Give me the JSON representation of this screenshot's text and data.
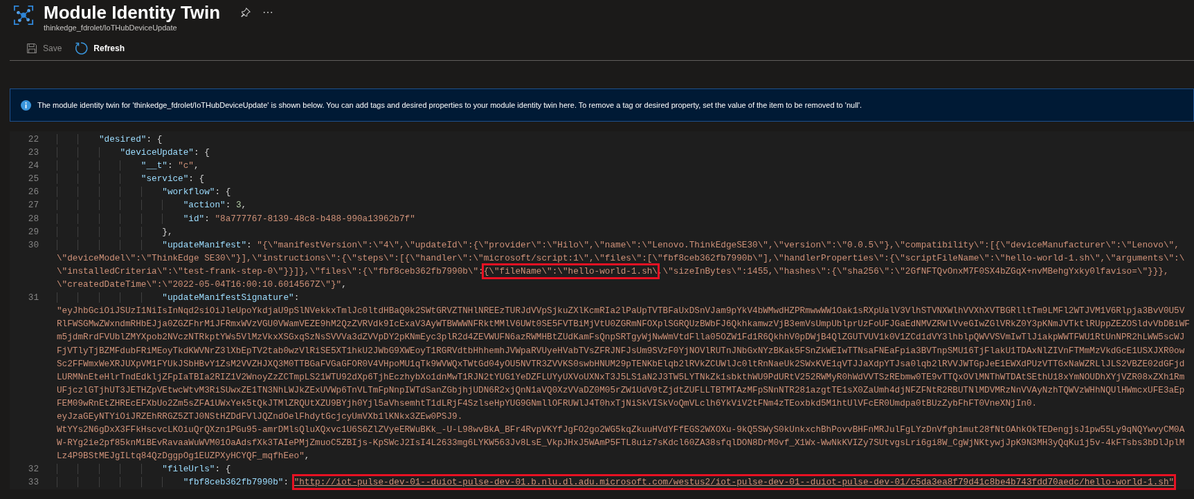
{
  "blade": {
    "title": "Module Identity Twin",
    "subtitle": "thinkedge_fdrolet/IoTHubDeviceUpdate"
  },
  "toolbar": [
    {
      "label": "Save",
      "kind": "save",
      "disabled": true
    },
    {
      "label": "Refresh",
      "kind": "refresh",
      "disabled": false
    }
  ],
  "info_banner": {
    "text": "The module identity twin for 'thinkedge_fdrolet/IoTHubDeviceUpdate' is shown below. You can add tags and desired properties to your module identity twin here. To remove a tag or desired property, set the value of the item to be removed to 'null'."
  },
  "editor": {
    "lines": [
      {
        "number": "22",
        "segments": [
          {
            "kind": "key",
            "text": "        \"desired\""
          },
          {
            "kind": "punct",
            "text": ": {"
          }
        ]
      },
      {
        "number": "23",
        "segments": [
          {
            "kind": "key",
            "text": "            \"deviceUpdate\""
          },
          {
            "kind": "punct",
            "text": ": {"
          }
        ]
      },
      {
        "number": "24",
        "segments": [
          {
            "kind": "key",
            "text": "                \"__t\""
          },
          {
            "kind": "punct",
            "text": ": "
          },
          {
            "kind": "string",
            "text": "\"c\""
          },
          {
            "kind": "punct",
            "text": ","
          }
        ]
      },
      {
        "number": "25",
        "segments": [
          {
            "kind": "key",
            "text": "                \"service\""
          },
          {
            "kind": "punct",
            "text": ": {"
          }
        ]
      },
      {
        "number": "26",
        "segments": [
          {
            "kind": "key",
            "text": "                    \"workflow\""
          },
          {
            "kind": "punct",
            "text": ": {"
          }
        ]
      },
      {
        "number": "27",
        "segments": [
          {
            "kind": "key",
            "text": "                        \"action\""
          },
          {
            "kind": "punct",
            "text": ": "
          },
          {
            "kind": "number",
            "text": "3"
          },
          {
            "kind": "punct",
            "text": ","
          }
        ]
      },
      {
        "number": "28",
        "segments": [
          {
            "kind": "key",
            "text": "                        \"id\""
          },
          {
            "kind": "punct",
            "text": ": "
          },
          {
            "kind": "string",
            "text": "\"8a777767-8139-48c8-b488-990a13962b7f\""
          }
        ]
      },
      {
        "number": "29",
        "segments": [
          {
            "kind": "punct",
            "text": "                    },"
          }
        ]
      },
      {
        "number": "30",
        "segments": [
          {
            "kind": "key",
            "text": "                    \"updateManifest\""
          },
          {
            "kind": "punct",
            "text": ": "
          },
          {
            "kind": "string",
            "text": "\"{\\\"manifestVersion\\\":\\\"4\\\",\\\"updateId\\\":{\\\"provider\\\":\\\"Hilo\\\",\\\"name\\\":\\\"Lenovo.ThinkEdgeSE30\\\",\\\"version\\\":\\\"0.0.5\\\"},\\\"compatibility\\\":[{\\\"deviceManufacturer\\\":\\\"Lenovo\\\","
          }
        ]
      },
      {
        "segments": [
          {
            "kind": "string",
            "text": "\\\"deviceModel\\\":\\\"ThinkEdge SE30\\\"}],\\\"instructions\\\":{\\\"steps\\\":[{\\\"handler\\\":\\\"microsoft/script:1\\\",\\\"files\\\":[\\\"fbf8ceb362fb7990b\\\"],\\\"handlerProperties\\\":{\\\"scriptFileName\\\":\\\"hello-world-1.sh\\\",\\\"arguments\\\":\\"
          }
        ]
      },
      {
        "segments": [
          {
            "kind": "string",
            "text": "\\\"installedCriteria\\\":\\\"test-frank-step-0\\\"}}]},\\\"files\\\":{\\\"fbf8ceb362fb7990b\\\":"
          },
          {
            "kind": "boxed",
            "text": "{\\\"fileName\\\":\\\"hello-world-1.sh\\"
          },
          {
            "kind": "string",
            "text": ",\\\"sizeInBytes\\\":1455,\\\"hashes\\\":{\\\"sha256\\\":\\\"2GfNFTQvOnxM7F0SX4bZGqX+nvMBehgYxky0lfaviso=\\\"}}},"
          }
        ]
      },
      {
        "segments": [
          {
            "kind": "string",
            "text": "\\\"createdDateTime\\\":\\\"2022-05-04T16:00:10.6014567Z\\\"}\""
          },
          {
            "kind": "punct",
            "text": ","
          }
        ]
      },
      {
        "number": "31",
        "segments": [
          {
            "kind": "key",
            "text": "                    \"updateManifestSignature\""
          },
          {
            "kind": "punct",
            "text": ":"
          }
        ]
      },
      {
        "segments": [
          {
            "kind": "string",
            "text": "\"eyJhbGciOiJSUzI1NiIsInNqd2siOiJleUpoYkdjaU9pSlNVekkxTmlJc0ltdHBaQ0k2SWtGRVZTNHlNREEzTURJdVVpSjkuZXlKcmRIa2lPaUpTVTBFaUxDSnVJam9pYkV4bWMwdHZPRmwwWW1Oak1sRXpUalV3VlhSTVNXWlhVVXhXVTBGRlltTm9LMFl2WTJVM1V6Rlpja3BvV0U5V"
          }
        ]
      },
      {
        "segments": [
          {
            "kind": "string",
            "text": "RlFWSGMwZWxndmRHbEJja0ZGZFhrM1JFRmxWVzVGU0VWamVEZE9hM2QzZVRVdk9IcExaV3AyWTBWWWNFRktMMlV6UWt0SE5FVTBiMjVtU0ZGRmNFOXplSGRQUzBWbFJ6QkhkamwzVjB3emVsUmpUblprUzFoUFJGaEdNMVZRWlVveGIwZGlVRkZ0Y3pKNmJVTktlRUppZEZOSldvVbDBiWF"
          }
        ]
      },
      {
        "segments": [
          {
            "kind": "string",
            "text": "m5jdmRrdFVUblZMYXpob2NVczNTRkptYWs5VlMzVkxXSGxqSzNsSVVVa3dZVVpDY2pKNmEyc3plR2d4ZEVWUFN6azRWMHBtZUdKamFsQnpSRTgyWjNwWmVtdFlla05OZW1Fd1R6QkhhV0pDWjB4QlZGUTVUV1k0V1ZCd1dVY3lhblpQWVVSVmIwTlJiakpWWTFWU1RtUnNPR2hLWW5scWJ"
          }
        ]
      },
      {
        "segments": [
          {
            "kind": "string",
            "text": "FjVTlyTjBZMFdubFRiMEoyTkdKWVNrZ3lXbEpTV2tab0wzVlRiSE5XT1hkU2JWbG9XWEoyT1RGRVdtbHhhemhJVWpaRVUyeHVabTVsZFRJNFJsUm9SVzF0YjNOVlRUTnJNbGxNYzBKak5FSnZkWEIwTTNsaFNEaFpia3BVTnpSMU16TjFlakU1TDAxNlZIVnFTMmMzVkdGcE1USXJXR0ow"
          }
        ]
      },
      {
        "segments": [
          {
            "kind": "string",
            "text": "Sc2FFWmxWeXRJUXpVM1FYUkJSbHBvY1ZsM2VVZHJXQ3M0TTBGaFVGaGFOR0V4VHpoMU1qTk9WVWQxTWtGd04yOU5NVTR3ZVVKS0swbHNUM29pTENKbElqb2lRVkZCUWlJc0ltRnNaeUk2SWxKVE1qVTJJaXdpYTJsa0lqb2lRVVJWTGpJeE1EWXdPUzVTTGxNaWZRLlJLS2VBZE02dGFjd"
          }
        ]
      },
      {
        "segments": [
          {
            "kind": "string",
            "text": "LURMNnEteHlrTndEdkljZFpIaTBIa2RIZ1V2WnoyZzZCTmpLS21WTU92dXp6TjhEczhybXo1dnMwT1RJN2tYUG1YeDZFLUYyUXVoUXNxT3J5LS1aN2J3TW5LYTNkZk1sbkthWU9PdURtV252RWMyR0hWdVVTSzREbmw0TE9vTTQxOVlMNThWTDAtSEthU18xYmNOUDhXYjVZR08xZXh1Rm"
          }
        ]
      },
      {
        "segments": [
          {
            "kind": "string",
            "text": "UFjczlGTjhUT3JETHZpVEtwcWtvM3RiSUwxZE1TN3NhLWJkZExUVWp6TnVLTmFpNnpIWTdSanZGbjhjUDN6R2xjQnN1aVQ0XzVVaDZ0M05rZW1UdV9tZjdtZUFLLTBTMTAzMFpSNnNTR281azgtTE1sX0ZaUmh4djNFZFNtR2RBUTNlMDVMRzNnVVAyNzhTQWVzWHhNQUlHWmcxUFE3aEp"
          }
        ]
      },
      {
        "segments": [
          {
            "kind": "string",
            "text": "FEM09wRnEtZHREcEFXbUo2Zm5sZFA1UWxYek5tQkJTMlZRQUtXZU9BYjh0Yjl5aVhsemhtT1dLRjF4SzlseHpYUG9GNmllOFRUWlJ4T0hxTjNiSkVISkVoQmVLclh6YkViV2tFNm4zTEoxbkd5M1htUlVFcER0Umdpa0tBUzZybFhFT0VneXNjIn0."
          }
        ]
      },
      {
        "segments": [
          {
            "kind": "string",
            "text": "eyJzaGEyNTYiOiJRZEhRRGZ5ZTJ0NStHZDdFVlJQZndOelFhdytGcjcyUmVXb1lKNkx3ZEw0PSJ9."
          }
        ]
      },
      {
        "segments": [
          {
            "kind": "string",
            "text": "WtYYs2N6gDxX3FFkHscvcLKOiuQrQXzn1PGu95-amrDMlsQluXQxvc1U6S6ZlZVyeERWuBKk_-U-L98wvBkA_BFr4RvpVKYfJgFO2go2WG5kqZkuuHVdYFfEGS2WXOXu-9kQ5SWyS0kUnkxchBhPovvBHFnMRJulFgLYzDnVfgh1mut28fNtOAhkOkTEDengjsJ1pw55Ly9qNQYwvyCM0A"
          }
        ]
      },
      {
        "segments": [
          {
            "kind": "string",
            "text": "W-RYg2ie2pf85knMiBEvRavaaWuWVM01OaAdsfXk3TAIePMjZmuoC5ZBIjs-KpSWcJ2IsI4L2633mg6LYKW563Jv8LsE_VkpJHxJ5WAmP5FTL8uiz7sKdcl60ZA38sfqlDON8DrM0vf_X1Wx-WwNkKVIZy7SUtvgsLri6gi8W_CgWjNKtywjJpK9N3MH3yQqKu1j5v-4kFTsbs3bDlJplM"
          }
        ]
      },
      {
        "segments": [
          {
            "kind": "string",
            "text": "Lz4P9BStMEJgILtq84QzDggpOg1EUZPXyHCYQF_mqfhEeo\""
          },
          {
            "kind": "punct",
            "text": ","
          }
        ]
      },
      {
        "number": "32",
        "segments": [
          {
            "kind": "key",
            "text": "                    \"fileUrls\""
          },
          {
            "kind": "punct",
            "text": ": {"
          }
        ]
      },
      {
        "number": "33",
        "segments": [
          {
            "kind": "key",
            "text": "                        \"fbf8ceb362fb7990b\""
          },
          {
            "kind": "punct",
            "text": ": "
          },
          {
            "kind": "boxed-link",
            "text": "\"http://iot-pulse-dev-01--duiot-pulse-dev-01.b.nlu.dl.adu.microsoft.com/westus2/iot-pulse-dev-01--duiot-pulse-dev-01/c5da3ea8f79d41c8be4b743fdd70aedc/hello-world-1.sh\""
          }
        ]
      }
    ]
  }
}
